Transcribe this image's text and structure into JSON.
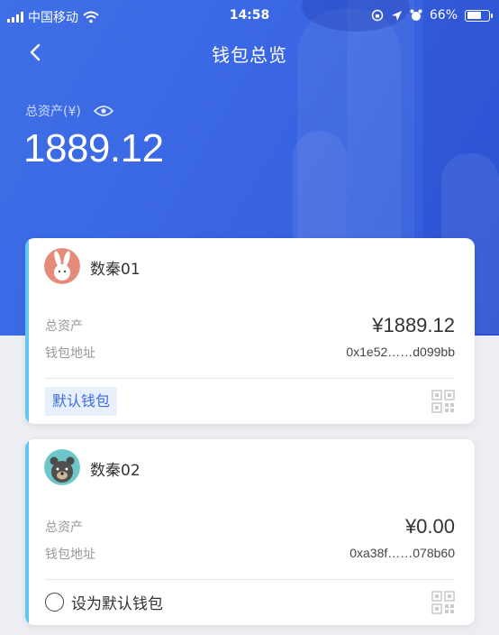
{
  "status_bar": {
    "carrier": "中国移动",
    "time": "14:58",
    "battery": "66%",
    "battery_level": 0.66
  },
  "nav": {
    "title": "钱包总览",
    "back_icon": "chevron-left-icon"
  },
  "summary": {
    "label": "总资产(¥)",
    "total": "1889.12",
    "visibility_icon": "eye-icon"
  },
  "wallets": [
    {
      "name": "数秦01",
      "avatar_icon": "rabbit-avatar",
      "asset_label": "总资产",
      "asset_value": "¥1889.12",
      "address_label": "钱包地址",
      "address_value": "0x1e52……d099bb",
      "default_label": "默认钱包",
      "is_default": true
    },
    {
      "name": "数秦02",
      "avatar_icon": "bear-avatar",
      "asset_label": "总资产",
      "asset_value": "¥0.00",
      "address_label": "钱包地址",
      "address_value": "0xa38f……078b60",
      "default_label": "设为默认钱包",
      "is_default": false
    }
  ],
  "colors": {
    "primary": "#3a66e3",
    "accent_stripe": "#5ec8ef",
    "badge_bg": "#e8effd",
    "badge_text": "#3d6ce0"
  }
}
